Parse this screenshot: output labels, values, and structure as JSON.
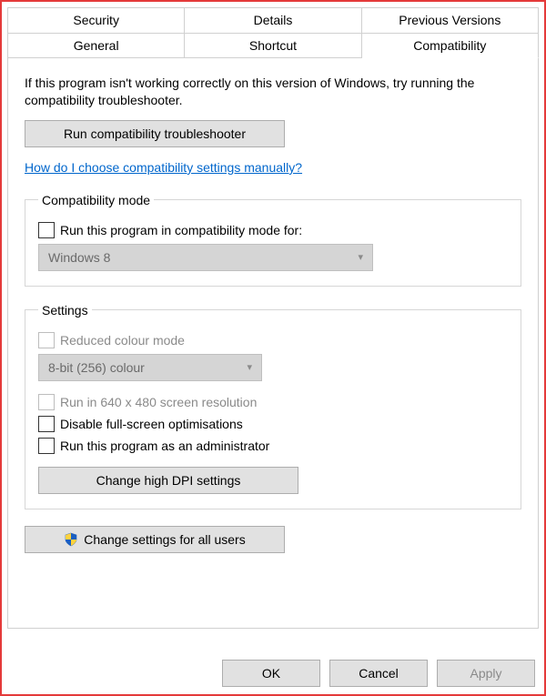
{
  "tabs": {
    "row1": [
      "Security",
      "Details",
      "Previous Versions"
    ],
    "row2": [
      "General",
      "Shortcut",
      "Compatibility"
    ],
    "active": "Compatibility"
  },
  "intro": "If this program isn't working correctly on this version of Windows, try running the compatibility troubleshooter.",
  "run_troubleshooter": "Run compatibility troubleshooter",
  "help_link": "How do I choose compatibility settings manually?",
  "compat_mode": {
    "legend": "Compatibility mode",
    "checkbox_label": "Run this program in compatibility mode for:",
    "select_value": "Windows 8"
  },
  "settings": {
    "legend": "Settings",
    "reduced_colour": "Reduced colour mode",
    "colour_select": "8-bit (256) colour",
    "run_640": "Run in 640 x 480 screen resolution",
    "disable_fullscreen": "Disable full-screen optimisations",
    "run_admin": "Run this program as an administrator",
    "change_dpi": "Change high DPI settings"
  },
  "change_all_users": "Change settings for all users",
  "footer": {
    "ok": "OK",
    "cancel": "Cancel",
    "apply": "Apply"
  }
}
